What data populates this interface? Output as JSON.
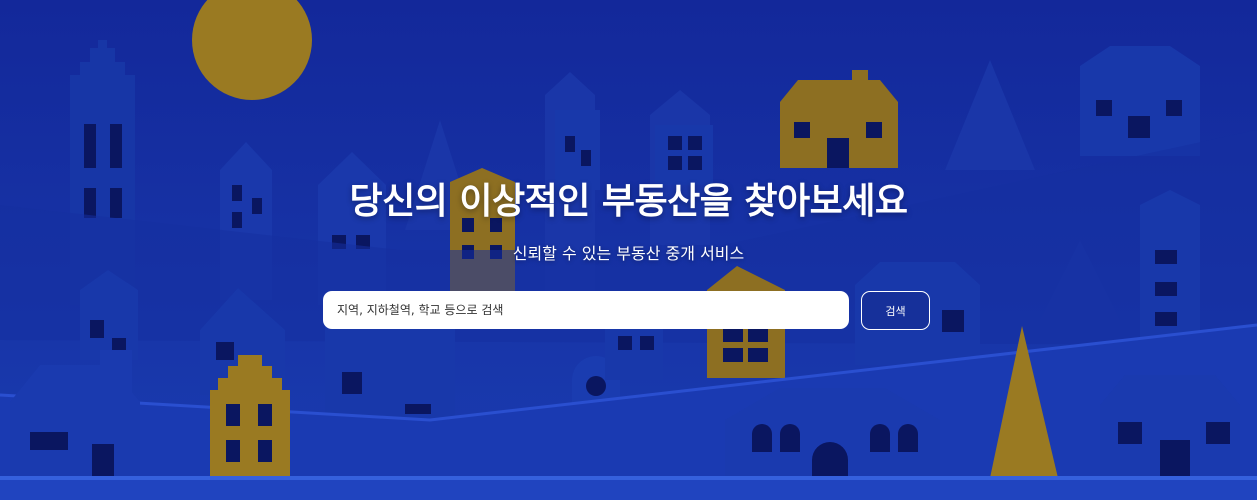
{
  "hero": {
    "title": "당신의 이상적인 부동산을 찾아보세요",
    "subtitle": "신뢰할 수 있는 부동산 중개 서비스"
  },
  "search": {
    "placeholder": "지역, 지하철역, 학교 등으로 검색",
    "value": "",
    "button_label": "검색"
  },
  "colors": {
    "background": "#1432a0",
    "gold_accent": "#9a7a22",
    "text": "#ffffff"
  }
}
